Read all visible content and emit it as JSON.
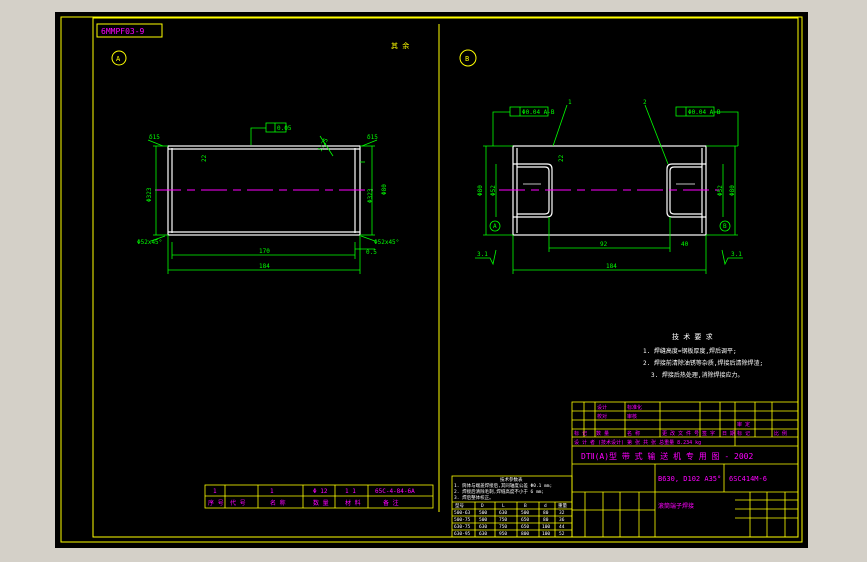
{
  "drawing_number_box": "6MMPF03-9",
  "views": [
    {
      "label": "A",
      "note": "其 余"
    },
    {
      "label": "B"
    }
  ],
  "view_a": {
    "geom_tol": "0.05",
    "left_thickness": "δ15",
    "right_thickness": "δ15",
    "wall": "22",
    "slope": "1:25",
    "dia_left": "Φ323",
    "dia_right": "Φ323",
    "dia_outer": "Φ80",
    "chamfer_left": "Φ52x45°",
    "chamfer_right": "Φ52x45°",
    "inner_len": "170",
    "total_len": "184",
    "end_gap": "0.5"
  },
  "view_b": {
    "tol_left": "Φ0.04 A-B",
    "tol_right": "Φ0.04 A-B",
    "callout_1": "1",
    "callout_2": "2",
    "wall": "22",
    "dia_left_outer": "Φ80",
    "dia_left_inner": "Φ52",
    "dia_right_outer": "Φ80",
    "dia_right_inner": "Φ52",
    "bore_len": "92",
    "bore_len_right": "40",
    "total_len": "184",
    "datum_a": "A",
    "datum_b": "B",
    "rough_left": "3.1",
    "rough_right": "3.1"
  },
  "tech_req": {
    "title": "技 术 要 求",
    "lines": [
      "1. 焊缝高度=钢板厚度,焊后调平;",
      "2. 焊接前清除油锈等杂质,焊接后清除焊渣;",
      "3. 焊接后热处理,消除焊接应力。"
    ]
  },
  "title_block": {
    "top_rows": [
      [
        "设计",
        "",
        "标准化",
        "",
        "",
        "",
        "",
        ""
      ],
      [
        "校对",
        "",
        "审核",
        "",
        "",
        "",
        "",
        ""
      ],
      [
        "标 记",
        "数 量",
        "名 称",
        "更 改 文 件 号",
        "签 字",
        "日 期",
        "标 记",
        "比 例"
      ],
      [
        "审 定",
        "",
        "",
        "",
        "",
        "",
        "",
        ""
      ]
    ],
    "summary_row": "设 计 者  (技术设计)  第 张  共 张  总重量  8.234 kg",
    "main_title": "DTⅡ(A)型  带 式 输 送 机 专 用 图 - 2002",
    "spec": "B630, D102 A35°",
    "code": "6SC414M-6",
    "part_name": "滚筒端子焊接"
  },
  "bom": {
    "row": [
      "1",
      "",
      "1",
      "Φ 12",
      "1 1",
      "65C-4-84-6A"
    ],
    "header": [
      "序 号",
      "代 号",
      "名 称",
      "数 量",
      "材 料",
      "备 注"
    ]
  },
  "param_table": {
    "title": "技术参数表",
    "notes": [
      "1. 筒体与端盖焊接后,其同轴度公差 Φ0.1 mm;",
      "2. 焊接后清除毛刺,焊缝高度不小于 6 mm;",
      "3. 焊后整体校正。"
    ],
    "header": [
      "型号",
      "D",
      "L",
      "B",
      "d",
      "重量"
    ],
    "rows": [
      [
        "500-63",
        "500",
        "630",
        "500",
        "80",
        "32"
      ],
      [
        "500-75",
        "500",
        "750",
        "650",
        "80",
        "36"
      ],
      [
        "630-75",
        "630",
        "750",
        "650",
        "100",
        "44"
      ],
      [
        "630-95",
        "630",
        "950",
        "800",
        "100",
        "52"
      ]
    ]
  }
}
